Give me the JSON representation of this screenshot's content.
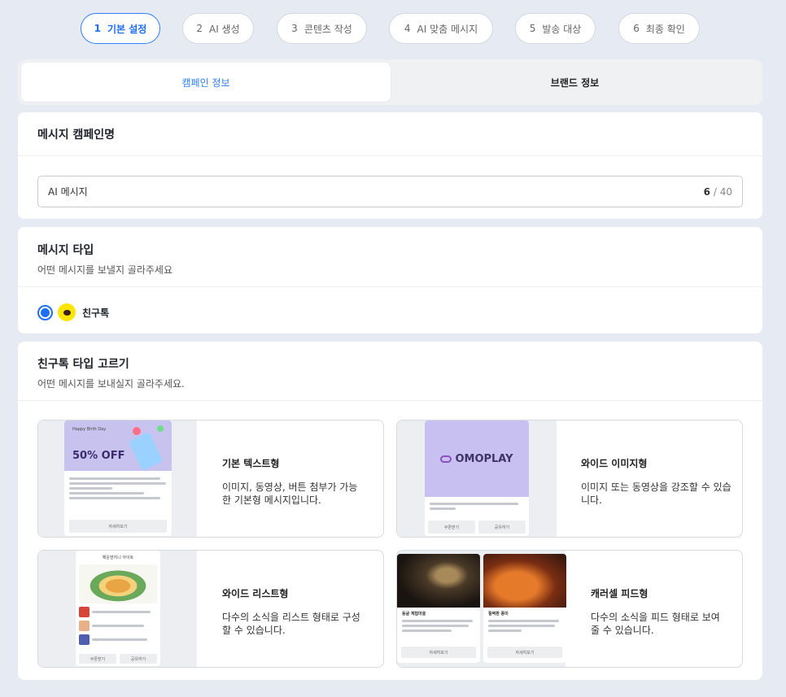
{
  "steps": [
    {
      "num": "1",
      "label": "기본 설정"
    },
    {
      "num": "2",
      "label": "AI 생성"
    },
    {
      "num": "3",
      "label": "콘텐츠 작성"
    },
    {
      "num": "4",
      "label": "AI 맞춤 메시지"
    },
    {
      "num": "5",
      "label": "발송 대상"
    },
    {
      "num": "6",
      "label": "최종 확인"
    }
  ],
  "tabs": {
    "campaign": "캠페인 정보",
    "brand": "브랜드 정보"
  },
  "campaign_name": {
    "title": "메시지 캠페인명",
    "value": "AI 메시지",
    "count": "6",
    "max": "/ 40"
  },
  "message_type": {
    "title": "메시지 타입",
    "subtitle": "어떤 메시지를 보낼지 골라주세요",
    "option": "친구톡"
  },
  "friendtalk": {
    "title": "친구톡 타입 고르기",
    "subtitle": "어떤 메시지를 보내실지 골라주세요.",
    "options": [
      {
        "title": "기본 텍스트형",
        "desc": "이미지, 동영상, 버튼 첨부가 가능한 기본형 메시지입니다."
      },
      {
        "title": "와이드 이미지형",
        "desc": "이미지 또는 동영상을 강조할 수 있습니다."
      },
      {
        "title": "와이드 리스트형",
        "desc": "다수의 소식을 리스트 형태로 구성할 수 있습니다."
      },
      {
        "title": "캐러셀 피드형",
        "desc": "다수의 소식을 피드 형태로 보여줄 수 있습니다."
      }
    ]
  },
  "previews": {
    "basic": {
      "header": "Happy Birth Day",
      "headline": "50% OFF",
      "button": "자세히보기"
    },
    "wide_image": {
      "brand": "OMOPLAY",
      "buttons": [
        "쿠폰받기",
        "공유하기"
      ]
    },
    "wide_list": {
      "header": "해운엔지니 아이트",
      "buttons": [
        "쿠폰받기",
        "공유하기"
      ]
    },
    "carousel": {
      "cards": [
        "동굴 체험마을",
        "절벽환 풍미"
      ],
      "button": "자세히보기"
    }
  },
  "colors": {
    "accent": "#1d6ef5",
    "kakao": "#fde500",
    "background": "#e6ebf3"
  }
}
